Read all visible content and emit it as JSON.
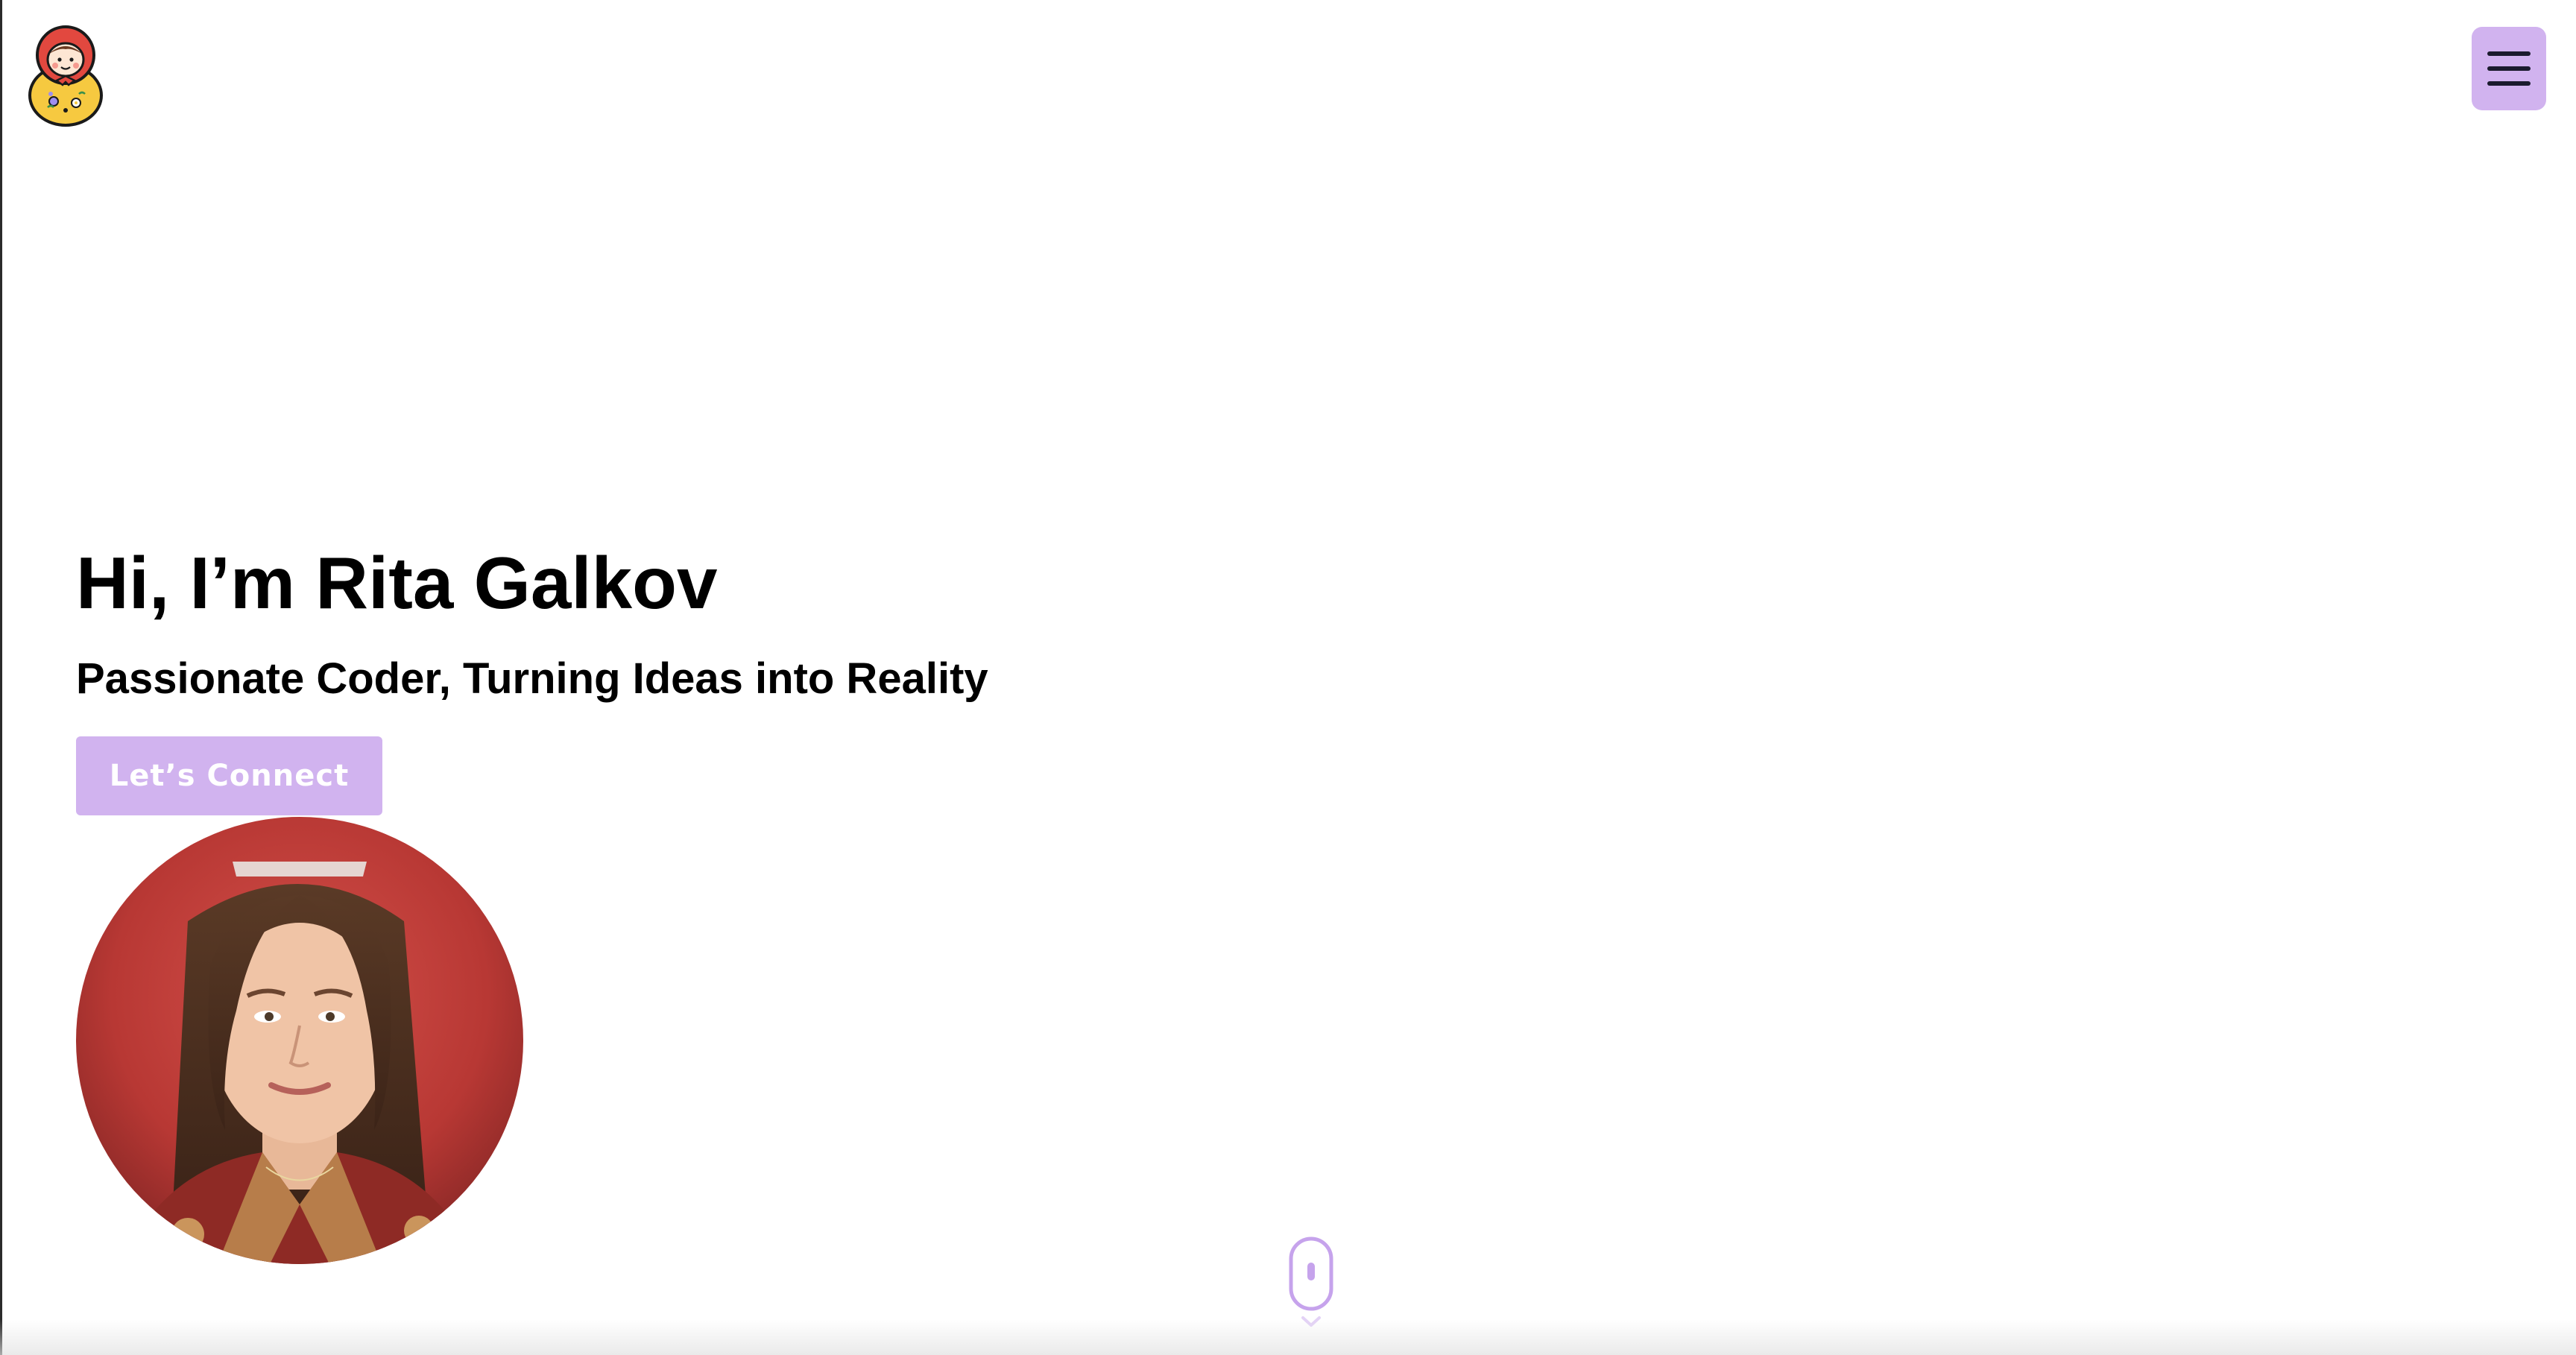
{
  "header": {
    "logo_icon": "matryoshka-doll-icon",
    "menu_icon": "hamburger-menu-icon"
  },
  "hero": {
    "title": "Hi, I’m Rita Galkov",
    "subtitle": "Passionate Coder, Turning Ideas into Reality",
    "cta_label": "Let’s Connect",
    "portrait_alt": "Rita Galkov"
  },
  "scroll_indicator": {
    "icon": "mouse-scroll-icon"
  },
  "colors": {
    "accent": "#d1b3ef",
    "accent_dark": "#a77fe0",
    "text": "#000000",
    "background": "#ffffff",
    "portrait_background": "#c63d3b"
  }
}
